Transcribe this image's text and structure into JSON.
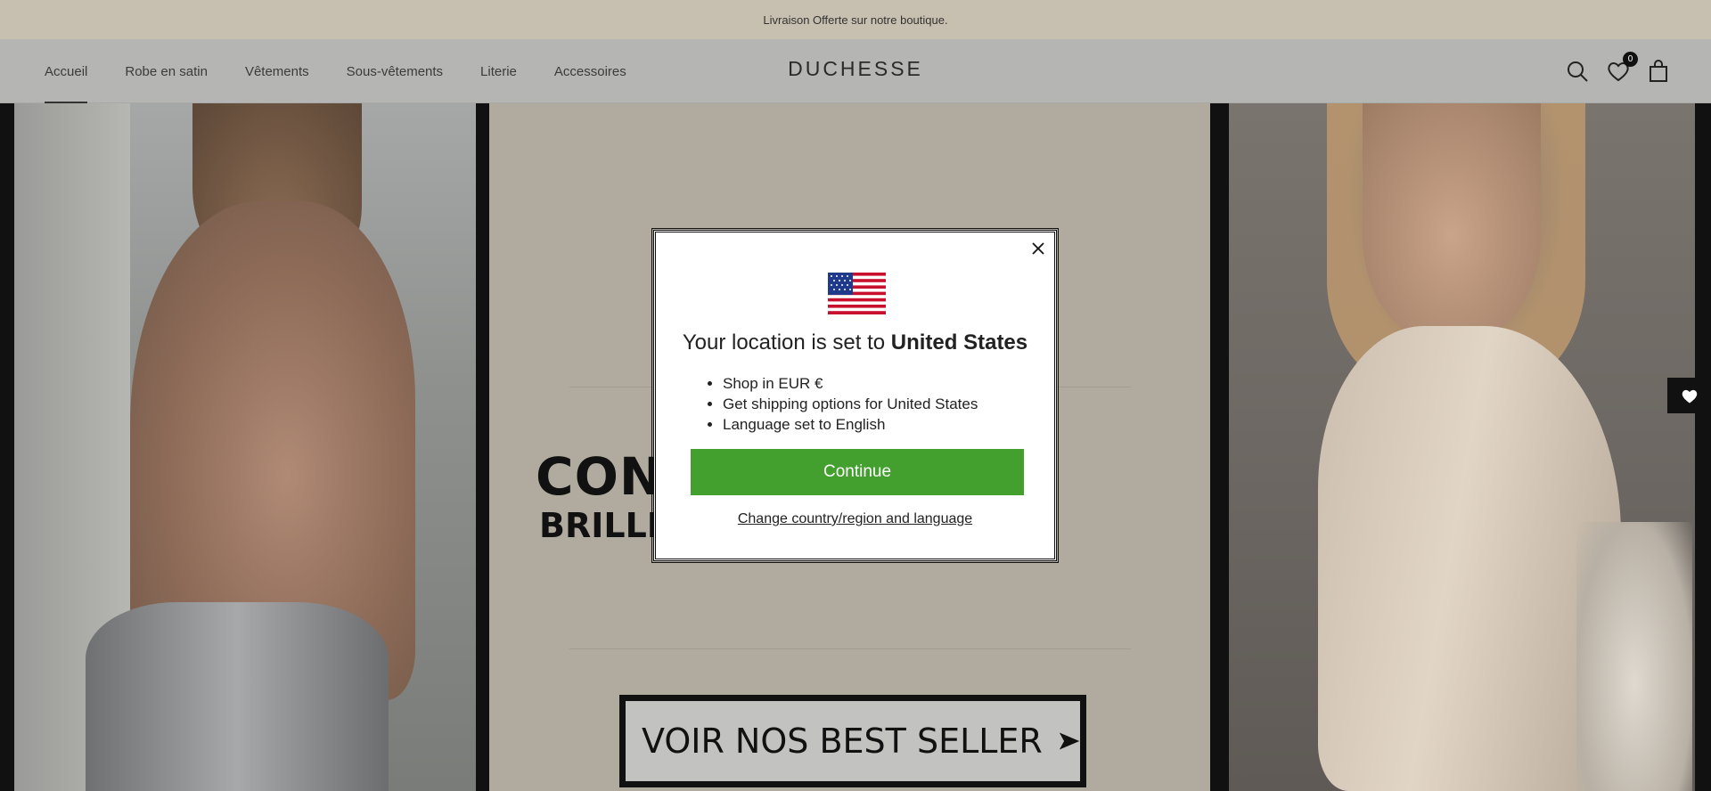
{
  "announcement": {
    "text": "Livraison Offerte sur notre boutique."
  },
  "header": {
    "nav": [
      {
        "label": "Accueil",
        "active": true
      },
      {
        "label": "Robe en satin"
      },
      {
        "label": "Vêtements"
      },
      {
        "label": "Sous-vêtements"
      },
      {
        "label": "Literie"
      },
      {
        "label": "Accessoires"
      }
    ],
    "logo": "DUCHESSE",
    "icons": [
      "search-icon",
      "heart-icon",
      "shopping-bag-icon"
    ],
    "wishlist_count": "0"
  },
  "hero": {
    "title": "CONFORT POUR",
    "subtitle": "BRILLER TOUTE LA NUIT",
    "cta_label": "VOIR NOS BEST SELLER"
  },
  "modal": {
    "heading_prefix": "Your location is set to ",
    "heading_country": "United States",
    "bullets": [
      "Shop in EUR €",
      "Get shipping options for United States",
      "Language set to English"
    ],
    "continue_label": "Continue",
    "change_label": "Change country/region and language"
  },
  "colors": {
    "announce_bg": "#c7bfb0",
    "header_bg": "#b5b5b3",
    "continue_bg": "#43a02e",
    "hero_mid_bg": "#b0ab9e"
  }
}
